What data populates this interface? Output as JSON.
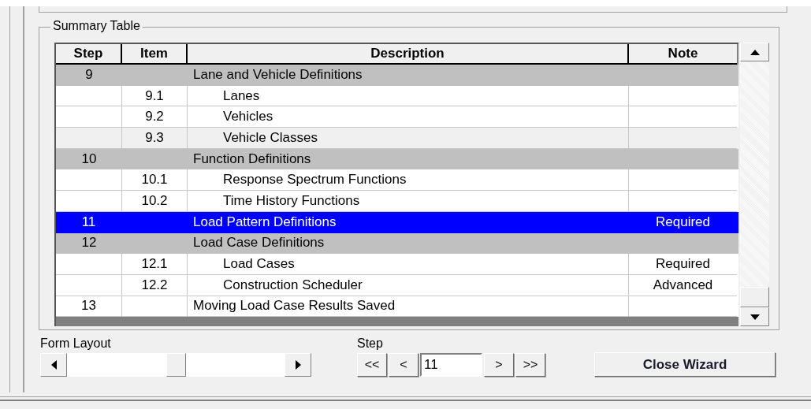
{
  "group_box": {
    "title": "Summary Table"
  },
  "table": {
    "columns": [
      "Step",
      "Item",
      "Description",
      "Note"
    ],
    "rows": [
      {
        "kind": "group",
        "step": "9",
        "item": "",
        "description": "Lane and Vehicle Definitions",
        "note": "",
        "selected": false,
        "shaded": false
      },
      {
        "kind": "item",
        "step": "",
        "item": "9.1",
        "description": "Lanes",
        "note": "",
        "selected": false,
        "shaded": false
      },
      {
        "kind": "item",
        "step": "",
        "item": "9.2",
        "description": "Vehicles",
        "note": "",
        "selected": false,
        "shaded": false
      },
      {
        "kind": "item",
        "step": "",
        "item": "9.3",
        "description": "Vehicle Classes",
        "note": "",
        "selected": false,
        "shaded": true
      },
      {
        "kind": "group",
        "step": "10",
        "item": "",
        "description": "Function Definitions",
        "note": "",
        "selected": false,
        "shaded": false
      },
      {
        "kind": "item",
        "step": "",
        "item": "10.1",
        "description": "Response Spectrum Functions",
        "note": "",
        "selected": false,
        "shaded": false
      },
      {
        "kind": "item",
        "step": "",
        "item": "10.2",
        "description": "Time History Functions",
        "note": "",
        "selected": false,
        "shaded": false
      },
      {
        "kind": "group",
        "step": "11",
        "item": "",
        "description": "Load Pattern Definitions",
        "note": "Required",
        "selected": true,
        "shaded": false
      },
      {
        "kind": "group",
        "step": "12",
        "item": "",
        "description": "Load Case Definitions",
        "note": "",
        "selected": false,
        "shaded": false
      },
      {
        "kind": "item",
        "step": "",
        "item": "12.1",
        "description": "Load Cases",
        "note": "Required",
        "selected": false,
        "shaded": false
      },
      {
        "kind": "item",
        "step": "",
        "item": "12.2",
        "description": "Construction Scheduler",
        "note": "Advanced",
        "selected": false,
        "shaded": false
      },
      {
        "kind": "plain",
        "step": "13",
        "item": "",
        "description": "Moving Load Case Results Saved",
        "note": "",
        "selected": false,
        "shaded": false
      }
    ]
  },
  "form_layout": {
    "label": "Form Layout"
  },
  "step": {
    "label": "Step",
    "first": "<<",
    "previous": "<",
    "value": "11",
    "next": ">",
    "last": ">>"
  },
  "close_button": "Close Wizard"
}
